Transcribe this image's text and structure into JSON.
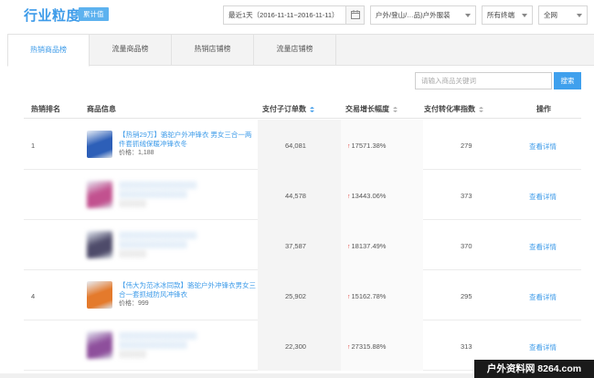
{
  "header": {
    "title": "行业粒度",
    "badge": "累计值",
    "date_range": "最近1天（2016-11-11~2016-11-11）",
    "category": "户外/登山/…品)户外服装",
    "terminal": "所有终端",
    "scope": "全网"
  },
  "tabs": [
    {
      "label": "热销商品榜",
      "active": true
    },
    {
      "label": "流量商品榜",
      "active": false
    },
    {
      "label": "热销店铺榜",
      "active": false
    },
    {
      "label": "流量店铺榜",
      "active": false
    }
  ],
  "search": {
    "placeholder": "请输入商品关键词",
    "button": "搜索"
  },
  "table": {
    "columns": [
      "热销排名",
      "商品信息",
      "支付子订单数",
      "交易增长幅度",
      "支付转化率指数",
      "操作"
    ],
    "rows": [
      {
        "rank": "1",
        "title": "【热销29万】骆驼户外冲锋衣 男女三合一两件套抓绒保暖冲锋衣冬",
        "price": "价格：1,188",
        "orders": "64,081",
        "growth": "17571.38%",
        "conversion": "279",
        "action": "查看详情",
        "blurred": false,
        "thumb_color": "#2d5fb8"
      },
      {
        "rank": "",
        "title": "",
        "price": "",
        "orders": "44,578",
        "growth": "13443.06%",
        "conversion": "373",
        "action": "查看详情",
        "blurred": true,
        "thumb_color": "#c2518f"
      },
      {
        "rank": "",
        "title": "",
        "price": "",
        "orders": "37,587",
        "growth": "18137.49%",
        "conversion": "370",
        "action": "查看详情",
        "blurred": true,
        "thumb_color": "#4e4b6a"
      },
      {
        "rank": "4",
        "title": "【伟大为范冰冰同款】骆驼户外冲锋衣男女三合一套抓绒防风冲锋衣",
        "price": "价格：999",
        "orders": "25,902",
        "growth": "15162.78%",
        "conversion": "295",
        "action": "查看详情",
        "blurred": false,
        "thumb_color": "#e47a2c"
      },
      {
        "rank": "",
        "title": "",
        "price": "",
        "orders": "22,300",
        "growth": "27315.88%",
        "conversion": "313",
        "action": "查看详情",
        "blurred": true,
        "thumb_color": "#8e4f9c"
      }
    ]
  },
  "watermark": "户外资料网 8264.com",
  "colors": {
    "accent": "#3d9be9",
    "up_arrow": "#e2433e"
  }
}
